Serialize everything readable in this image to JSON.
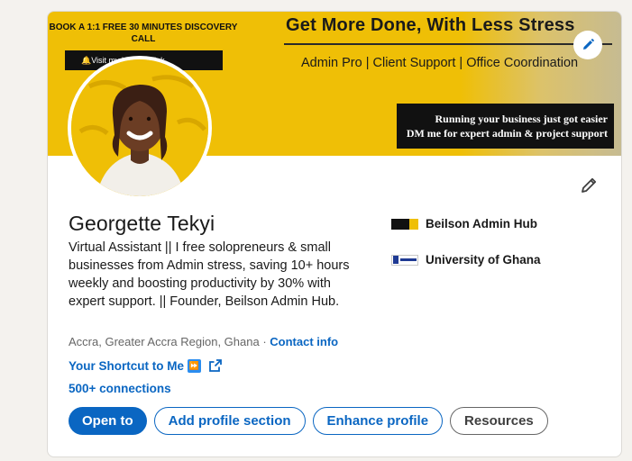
{
  "banner": {
    "cta": "BOOK A 1:1 FREE 30 MINUTES DISCOVERY CALL",
    "booking_text": "🔔Visit my booking link",
    "headline": "Get More Done, With Less Stress",
    "services": "Admin Pro |  Client Support |  Office Coordination",
    "tagline_1": "Running your business just got easier",
    "tagline_2": "DM me for expert admin & project support"
  },
  "profile": {
    "name": "Georgette Tekyi",
    "headline": "Virtual Assistant || I free solopreneurs & small businesses from Admin stress, saving 10+ hours weekly and boosting productivity by 30% with expert support. || Founder, Beilson Admin Hub.",
    "location": "Accra, Greater Accra Region, Ghana",
    "separator": " · ",
    "contact_label": "Contact info",
    "shortcut_label": "Your Shortcut to Me",
    "shortcut_emoji": "⏩",
    "connections": "500+ connections"
  },
  "orgs": [
    {
      "name": "Beilson Admin Hub",
      "icon": "beilson-logo"
    },
    {
      "name": "University of Ghana",
      "icon": "ug-logo"
    }
  ],
  "actions": {
    "open_to": "Open to",
    "add_section": "Add profile section",
    "enhance": "Enhance profile",
    "resources": "Resources"
  },
  "colors": {
    "accent": "#0a66c2",
    "banner_yellow": "#efbf06"
  },
  "icons": {
    "edit_banner": "pencil-icon",
    "edit_intro": "pencil-icon",
    "external_link": "external-link-icon"
  }
}
